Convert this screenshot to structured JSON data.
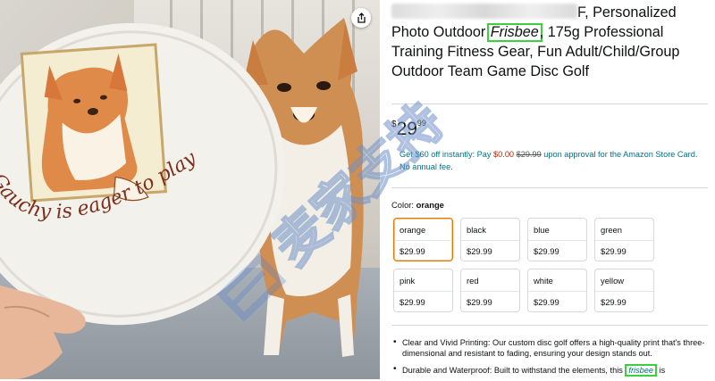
{
  "photo": {
    "disc_text": "Gauchy is eager to play frisbee",
    "share_icon": "share-icon"
  },
  "product": {
    "title_before": "F, Personalized Photo Outdoor ",
    "title_keyword": "Frisbee",
    "title_after": ", 175g Professional Training Fitness Gear, Fun Adult/Child/Group Outdoor Team Game Disc Golf",
    "price_currency": "$",
    "price_whole": "29",
    "price_fraction": "99",
    "offer_text_1": "Get $60 off instantly: Pay ",
    "offer_pay": "$0.00",
    "offer_old": "$29.99",
    "offer_text_2": " upon approval for the Amazon Store Card. No annual fee.",
    "color_label": "Color:",
    "color_value": "orange"
  },
  "swatches": [
    {
      "name": "orange",
      "price": "$29.99",
      "selected": true
    },
    {
      "name": "black",
      "price": "$29.99"
    },
    {
      "name": "blue",
      "price": "$29.99"
    },
    {
      "name": "green",
      "price": "$29.99"
    },
    {
      "name": "pink",
      "price": "$29.99"
    },
    {
      "name": "red",
      "price": "$29.99"
    },
    {
      "name": "white",
      "price": "$29.99"
    },
    {
      "name": "yellow",
      "price": "$29.99"
    }
  ],
  "bullets": {
    "b1": "Clear and Vivid Printing: Our custom disc golf offers a high-quality print that's three-dimensional and resistant to fading, ensuring your design stands out.",
    "b2_before": "Durable and Waterproof: Built to withstand the elements, this ",
    "b2_keyword": "frisbee",
    "b2_after": " is"
  },
  "watermark": {
    "text": "麦家支持"
  },
  "colors": {
    "link": "#007185",
    "price_red": "#b12704",
    "selected_border": "#e77600",
    "highlight_box": "#3ad13a"
  }
}
